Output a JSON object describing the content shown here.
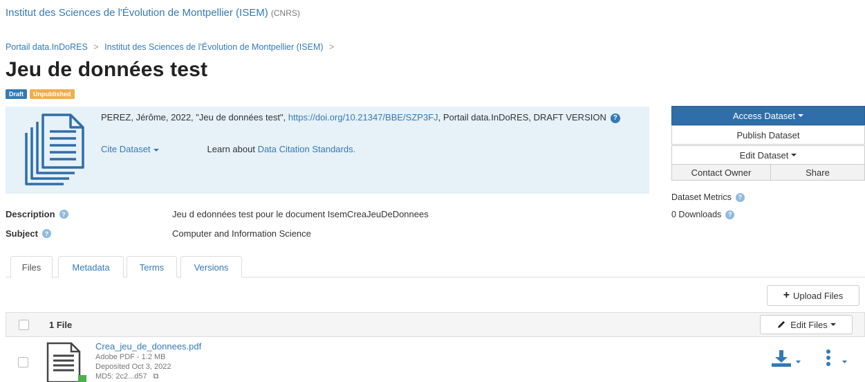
{
  "header": {
    "org_name": "Institut des Sciences de l'Évolution de Montpellier (ISEM)",
    "org_affiliation": "(CNRS)"
  },
  "breadcrumb": {
    "items": [
      "Portail data.InDoRES",
      "Institut des Sciences de l'Évolution de Montpellier (ISEM)"
    ],
    "separator": ">"
  },
  "dataset": {
    "title": "Jeu de données test",
    "labels": {
      "draft": "Draft",
      "unpublished": "Unpublished"
    },
    "citation": {
      "text_before": "PEREZ, Jérôme, 2022, \"Jeu de données test\", ",
      "doi": "https://doi.org/10.21347/BBE/SZP3FJ",
      "text_after": ", Portail data.InDoRES, DRAFT VERSION",
      "cite_dataset": "Cite Dataset",
      "learn_prefix": "Learn about ",
      "learn_link": "Data Citation Standards."
    },
    "metadata": {
      "description_label": "Description",
      "description_value": "Jeu d edonnées test pour le document IsemCreaJeuDeDonnees",
      "subject_label": "Subject",
      "subject_value": "Computer and Information Science"
    }
  },
  "sidebar": {
    "access_dataset": "Access Dataset",
    "publish_dataset": "Publish Dataset",
    "edit_dataset": "Edit Dataset",
    "contact_owner": "Contact Owner",
    "share": "Share",
    "metrics_label": "Dataset Metrics",
    "downloads": "0 Downloads"
  },
  "tabs": [
    "Files",
    "Metadata",
    "Terms",
    "Versions"
  ],
  "files": {
    "upload_label": "Upload Files",
    "count_label": "1 File",
    "edit_files_label": "Edit Files",
    "items": [
      {
        "name": "Crea_jeu_de_donnees.pdf",
        "type_size": "Adobe PDF - 1.2 MB",
        "deposited": "Deposited Oct 3, 2022",
        "md5": "MD5: 2c2...d57"
      }
    ]
  },
  "colors": {
    "link": "#337ab7",
    "primary_button": "#2f6ea8",
    "draft_badge": "#337ab7",
    "unpublished_badge": "#f0ad4e",
    "citation_bg": "#e6f1f8"
  }
}
